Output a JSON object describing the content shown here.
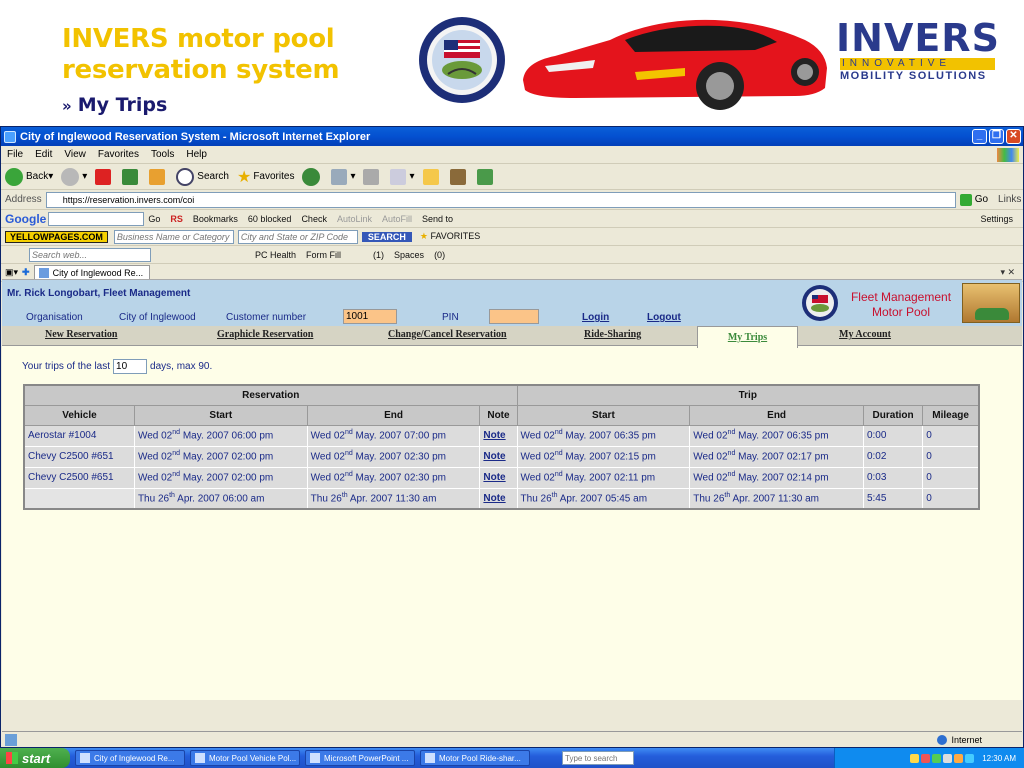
{
  "slide": {
    "title_line1": "INVERS motor pool",
    "title_line2": "reservation system",
    "arrow": "»",
    "subtitle": "My Trips",
    "invers_word": "INVERS",
    "invers_tagline": "INNOVATIVE",
    "invers_tagline2": "MOBILITY SOLUTIONS",
    "seal_text": "CITY OF INGLEWOOD · INC. CALIFORNIA 1908"
  },
  "browser": {
    "window_title": "City of Inglewood Reservation System - Microsoft Internet Explorer",
    "menu": [
      "File",
      "Edit",
      "View",
      "Favorites",
      "Tools",
      "Help"
    ],
    "toolbar": {
      "back": "Back",
      "search": "Search",
      "favorites": "Favorites"
    },
    "address_label": "Address",
    "address_value": "https://reservation.invers.com/coi",
    "go": "Go",
    "links": "Links",
    "google": {
      "logo": "Google",
      "go": "Go",
      "rs": "RS",
      "bookmarks": "Bookmarks",
      "blocked": "60 blocked",
      "check": "Check",
      "autolink": "AutoLink",
      "autofill": "AutoFill",
      "sendto": "Send to",
      "settings": "Settings"
    },
    "yellowpages": {
      "badge": "YELLOWPAGES.COM",
      "business_placeholder": "Business Name or Category",
      "location_placeholder": "City and State or ZIP Code",
      "search": "SEARCH",
      "favorites": "FAVORITES"
    },
    "searchbar": {
      "placeholder": "Search web...",
      "pchealth": "PC Health",
      "formfill": "Form Fill",
      "mail": "(1)",
      "spaces": "Spaces",
      "im": "(0)"
    },
    "tab_label": "City of Inglewood Re...",
    "status_zone": "Internet"
  },
  "app": {
    "user": "Mr. Rick Longobart, Fleet Management",
    "org_label": "Organisation",
    "org_value": "City of Inglewood",
    "customer_label": "Customer number",
    "customer_value": "1001",
    "pin_label": "PIN",
    "pin_value": "",
    "login": "Login",
    "logout": "Logout",
    "fleet_title_1": "Fleet Management",
    "fleet_title_2": "Motor Pool",
    "nav": {
      "new_res": "New Reservation",
      "graphic_res": "Graphicle Reservation",
      "change": "Change/Cancel Reservation",
      "ride": "Ride-Sharing",
      "mytrips": "My Trips",
      "account": "My Account"
    },
    "trips_prefix": "Your trips of the last",
    "trips_days": "10",
    "trips_suffix": "days, max 90.",
    "table": {
      "group_res": "Reservation",
      "group_trip": "Trip",
      "col_vehicle": "Vehicle",
      "col_start": "Start",
      "col_end": "End",
      "col_note": "Note",
      "col_trip_start": "Start",
      "col_trip_end": "End",
      "col_duration": "Duration",
      "col_mileage": "Mileage"
    },
    "rows": [
      {
        "vehicle": "Aerostar #1004",
        "rs_a": "Wed 02",
        "rs_s": "nd",
        "rs_b": " May. 2007 06:00 pm",
        "re_a": "Wed 02",
        "re_s": "nd",
        "re_b": " May. 2007 07:00 pm",
        "note": "Note",
        "ts_a": "Wed 02",
        "ts_s": "nd",
        "ts_b": " May. 2007 06:35 pm",
        "te_a": "Wed 02",
        "te_s": "nd",
        "te_b": " May. 2007 06:35 pm",
        "duration": "0:00",
        "mileage": "0"
      },
      {
        "vehicle": "Chevy C2500 #651",
        "rs_a": "Wed 02",
        "rs_s": "nd",
        "rs_b": " May. 2007 02:00 pm",
        "re_a": "Wed 02",
        "re_s": "nd",
        "re_b": " May. 2007 02:30 pm",
        "note": "Note",
        "ts_a": "Wed 02",
        "ts_s": "nd",
        "ts_b": " May. 2007 02:15 pm",
        "te_a": "Wed 02",
        "te_s": "nd",
        "te_b": " May. 2007 02:17 pm",
        "duration": "0:02",
        "mileage": "0"
      },
      {
        "vehicle": "Chevy C2500 #651",
        "rs_a": "Wed 02",
        "rs_s": "nd",
        "rs_b": " May. 2007 02:00 pm",
        "re_a": "Wed 02",
        "re_s": "nd",
        "re_b": " May. 2007 02:30 pm",
        "note": "Note",
        "ts_a": "Wed 02",
        "ts_s": "nd",
        "ts_b": " May. 2007 02:11 pm",
        "te_a": "Wed 02",
        "te_s": "nd",
        "te_b": " May. 2007 02:14 pm",
        "duration": "0:03",
        "mileage": "0"
      },
      {
        "vehicle": "",
        "rs_a": "Thu 26",
        "rs_s": "th",
        "rs_b": " Apr. 2007 06:00 am",
        "re_a": "Thu 26",
        "re_s": "th",
        "re_b": " Apr. 2007 11:30 am",
        "note": "Note",
        "ts_a": "Thu 26",
        "ts_s": "th",
        "ts_b": " Apr. 2007 05:45 am",
        "te_a": "Thu 26",
        "te_s": "th",
        "te_b": " Apr. 2007 11:30 am",
        "duration": "5:45",
        "mileage": "0"
      }
    ]
  },
  "taskbar": {
    "start": "start",
    "tasks": [
      "City of Inglewood Re...",
      "Motor Pool Vehicle Pol...",
      "Microsoft PowerPoint ...",
      "Motor Pool Ride-shar..."
    ],
    "search_placeholder": "Type to search",
    "clock": "12:30 AM"
  },
  "colors": {
    "title_yellow": "#f2c200",
    "navy": "#1a2a88",
    "strip_blue": "#b9d4e8",
    "page_bg": "#fefee8",
    "field_orange": "#fbc488",
    "fleet_red": "#c8102e",
    "mytrips_green": "#3b8a3b"
  }
}
